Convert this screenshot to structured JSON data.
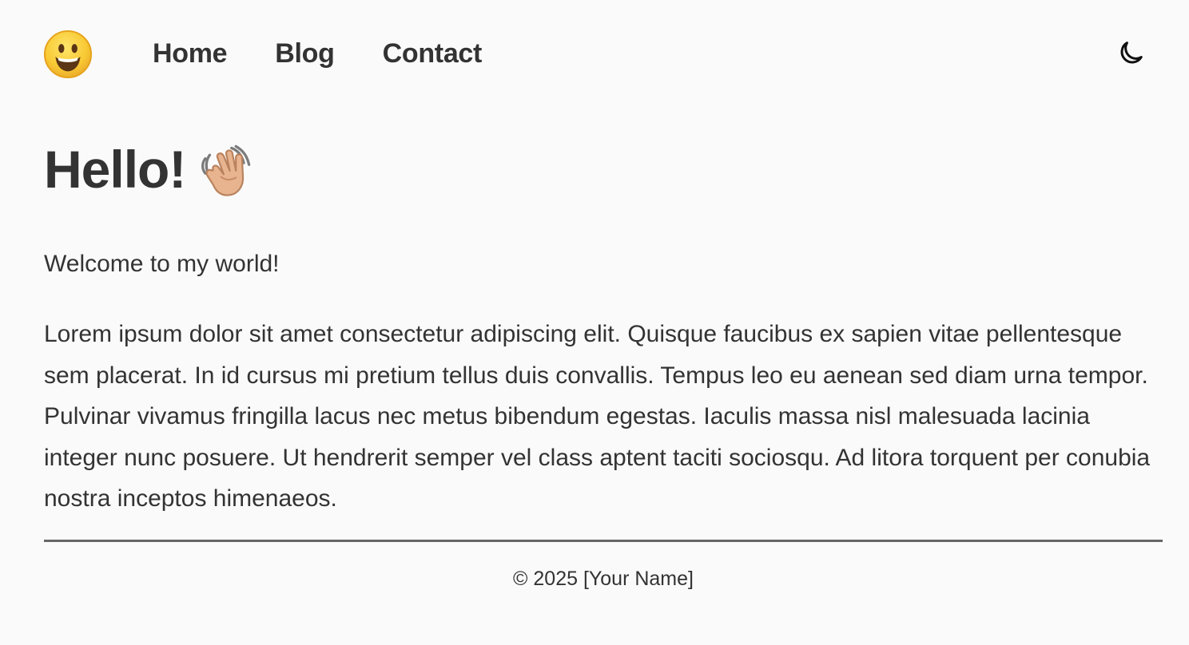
{
  "header": {
    "logo_icon": "grinning-face-emoji-icon",
    "nav": {
      "home": "Home",
      "blog": "Blog",
      "contact": "Contact"
    },
    "theme_icon": "moon-icon"
  },
  "main": {
    "title": "Hello!",
    "title_icon": "waving-hand-emoji-icon",
    "welcome": "Welcome to my world!",
    "paragraph": "Lorem ipsum dolor sit amet consectetur adipiscing elit. Quisque faucibus ex sapien vitae pellentesque sem placerat. In id cursus mi pretium tellus duis convallis. Tempus leo eu aenean sed diam urna tempor. Pulvinar vivamus fringilla lacus nec metus bibendum egestas. Iaculis massa nisl malesuada lacinia integer nunc posuere. Ut hendrerit semper vel class aptent taciti sociosqu. Ad litora torquent per conubia nostra inceptos himenaeos."
  },
  "footer": {
    "copyright": "© 2025 [Your Name]"
  },
  "colors": {
    "background": "#fafafa",
    "text": "#333333",
    "divider": "#666666",
    "emoji_yellow": "#f8c933",
    "emoji_outline": "#e6a21b",
    "hand_skin": "#e8b48f"
  }
}
